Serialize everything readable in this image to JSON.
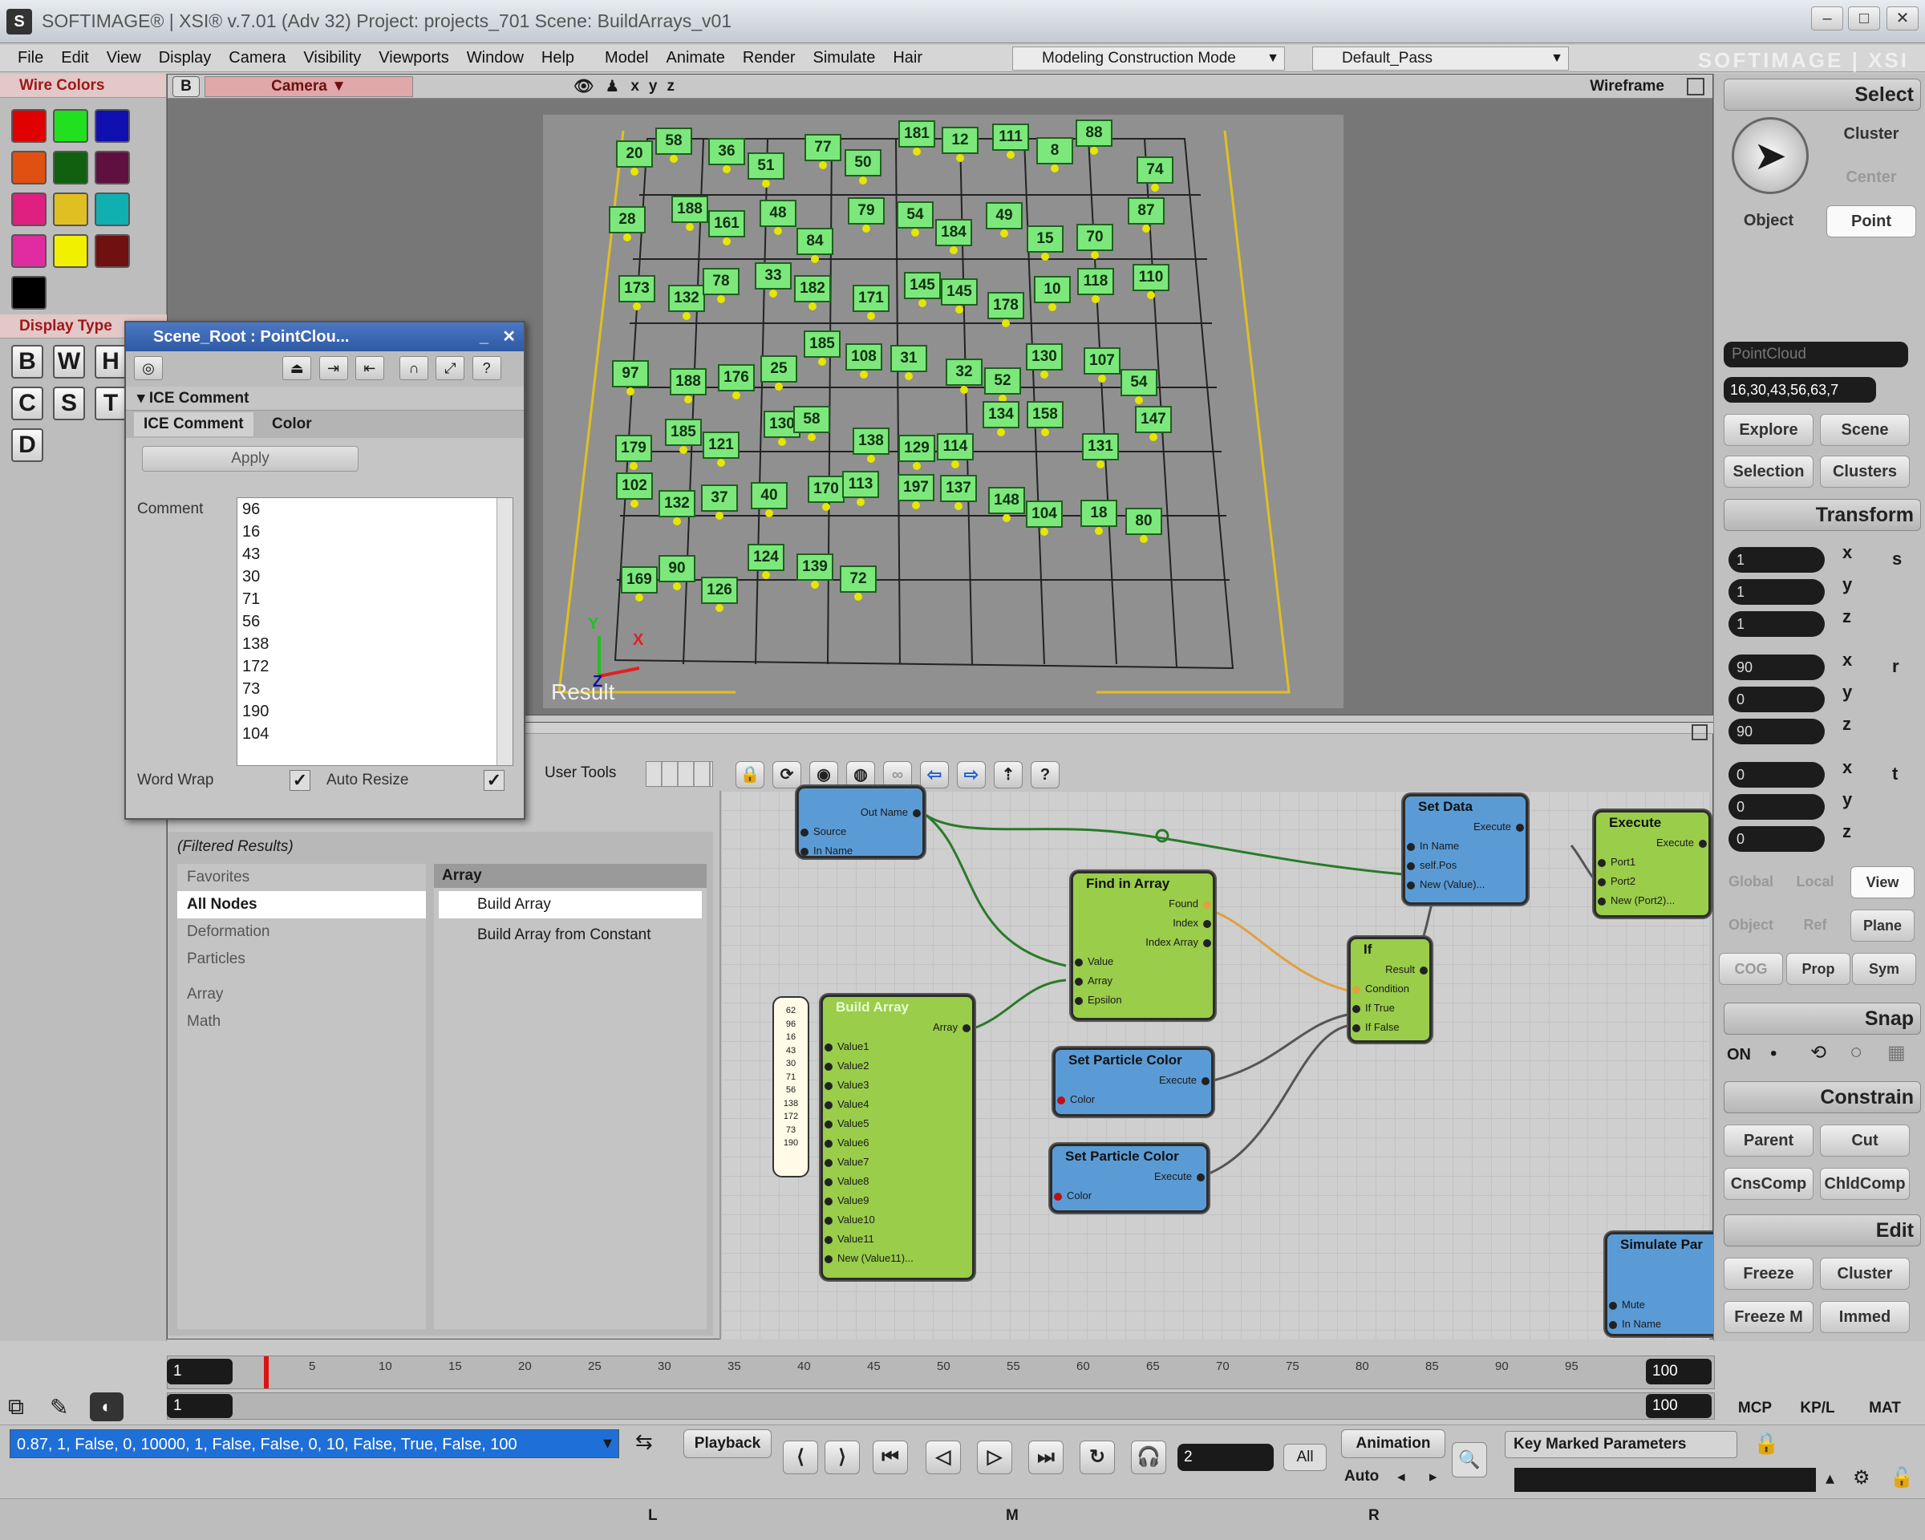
{
  "window": {
    "title": "SOFTIMAGE® | XSI® v.7.01 (Adv 32) Project: projects_701   Scene: BuildArrays_v01",
    "app_icon": "softimage-icon",
    "controls": [
      "–",
      "□",
      "✕"
    ]
  },
  "menubar": {
    "items": [
      "File",
      "Edit",
      "View",
      "Display",
      "Camera",
      "Visibility",
      "Viewports",
      "Window",
      "Help",
      "Model",
      "Animate",
      "Render",
      "Simulate",
      "Hair"
    ],
    "mode": "Modeling Construction Mode",
    "pass": "Default_Pass",
    "brand": "SOFTIMAGE | XSI"
  },
  "left_palette": {
    "wire_colors_title": "Wire Colors",
    "wire_colors": [
      "#e00000",
      "#20e020",
      "#1010b0",
      "#e05010",
      "#106010",
      "#601040",
      "#e02080",
      "#e0c020",
      "#10b0b0",
      "#e02ca0",
      "#f0f000",
      "#701010",
      "#000000"
    ],
    "display_type_title": "Display Type",
    "display_types": [
      "B",
      "W",
      "H",
      "C",
      "S",
      "T",
      "D"
    ]
  },
  "viewport": {
    "label": "B",
    "camera": "Camera",
    "axes": [
      "x",
      "y",
      "z"
    ],
    "mode": "Wireframe",
    "result_label": "Result",
    "axis_x": "X",
    "axis_y": "Y",
    "axis_z": "Z",
    "tags": [
      "20",
      "58",
      "36",
      "51",
      "77",
      "50",
      "181",
      "12",
      "111",
      "8",
      "88",
      "74",
      "28",
      "188",
      "161",
      "48",
      "84",
      "79",
      "54",
      "184",
      "49",
      "15",
      "70",
      "87",
      "173",
      "132",
      "78",
      "33",
      "182",
      "171",
      "145",
      "145",
      "178",
      "10",
      "118",
      "110",
      "97",
      "188",
      "176",
      "25",
      "185",
      "108",
      "31",
      "32",
      "52",
      "130",
      "107",
      "54",
      "179",
      "185",
      "121",
      "130",
      "58",
      "138",
      "129",
      "114",
      "134",
      "158",
      "131",
      "147",
      "102",
      "132",
      "37",
      "40",
      "170",
      "113",
      "197",
      "137",
      "148",
      "104",
      "18",
      "80",
      "169",
      "90",
      "126",
      "124",
      "139",
      "72"
    ]
  },
  "property_editor": {
    "title": "Scene_Root : PointClou...",
    "section": "ICE Comment",
    "tabs": [
      "ICE Comment",
      "Color"
    ],
    "apply_label": "Apply",
    "comment_label": "Comment",
    "comment_lines": [
      "96",
      "16",
      "43",
      "30",
      "71",
      "56",
      "138",
      "172",
      "73",
      "190",
      "104"
    ],
    "word_wrap_label": "Word Wrap",
    "auto_resize_label": "Auto Resize"
  },
  "ice_tree": {
    "user_tools_label": "User Tools",
    "filtered_results": "(Filtered Results)",
    "categories": [
      "Favorites",
      "All Nodes",
      "Deformation",
      "Particles",
      "Array",
      "Math"
    ],
    "selected_category": "All Nodes",
    "group_header": "Array",
    "compounds": [
      "Build Array",
      "Build Array from Constant"
    ],
    "nodes": {
      "get": {
        "title": "",
        "ports_out": [
          "Out Name"
        ],
        "ports_in": [
          "Source",
          "In Name"
        ]
      },
      "set_data": {
        "title": "Set Data",
        "out": "Execute",
        "ports_in": [
          "In Name",
          "self.Pos",
          "New (Value)..."
        ]
      },
      "execute": {
        "title": "Execute",
        "out": "Execute",
        "ports_in": [
          "Port1",
          "Port2",
          "New (Port2)..."
        ]
      },
      "find_in_array": {
        "title": "Find in Array",
        "outs": [
          "Found",
          "Index",
          "Index Array"
        ],
        "ins": [
          "Value",
          "Array",
          "Epsilon"
        ]
      },
      "if": {
        "title": "If",
        "out": "Result",
        "ins": [
          "Condition",
          "If True",
          "If False"
        ]
      },
      "build_array": {
        "title": "Build Array",
        "out": "Array",
        "ins": [
          "Value1",
          "Value2",
          "Value3",
          "Value4",
          "Value5",
          "Value6",
          "Value7",
          "Value8",
          "Value9",
          "Value10",
          "Value11",
          "New (Value11)..."
        ]
      },
      "set_color_1": {
        "title": "Set Particle Color",
        "out": "Execute",
        "in": "Color"
      },
      "set_color_2": {
        "title": "Set Particle Color",
        "out": "Execute",
        "in": "Color"
      },
      "simulate": {
        "title": "Simulate Par",
        "ins": [
          "Mute",
          "In Name"
        ]
      }
    },
    "comment_node_values": [
      "62",
      "96",
      "16",
      "43",
      "30",
      "71",
      "56",
      "138",
      "172",
      "73",
      "190"
    ]
  },
  "right_panel": {
    "select_title": "Select",
    "cluster": "Cluster",
    "center": "Center",
    "object": "Object",
    "point": "Point",
    "pointcloud_field": "PointCloud",
    "selection_field": "16,30,43,56,63,7",
    "explore": "Explore",
    "scene": "Scene",
    "selection": "Selection",
    "clusters": "Clusters",
    "transform_title": "Transform",
    "scale": [
      "1",
      "1",
      "1"
    ],
    "rotate": [
      "90",
      "0",
      "90"
    ],
    "translate": [
      "0",
      "0",
      "0"
    ],
    "axes": [
      "x",
      "y",
      "z"
    ],
    "srt": [
      "s",
      "r",
      "t"
    ],
    "ref_row1": [
      "Global",
      "Local",
      "View"
    ],
    "ref_row2": [
      "Object",
      "Ref",
      "Plane"
    ],
    "ref_row3": [
      "COG",
      "Prop",
      "Sym"
    ],
    "snap_title": "Snap",
    "snap_on": "ON",
    "constrain_title": "Constrain",
    "constrain_buttons": [
      "Parent",
      "Cut",
      "CnsComp",
      "ChldComp"
    ],
    "edit_title": "Edit",
    "edit_buttons": [
      "Freeze",
      "Cluster",
      "Freeze M",
      "Immed"
    ],
    "bottom_tabs": [
      "MCP",
      "KP/L",
      "MAT"
    ]
  },
  "timeline": {
    "start": "1",
    "end": "100",
    "range_start": "1",
    "range_end": "100",
    "ticks": [
      "5",
      "10",
      "15",
      "20",
      "25",
      "30",
      "35",
      "40",
      "45",
      "50",
      "55",
      "60",
      "65",
      "70",
      "75",
      "80",
      "85",
      "90",
      "95"
    ]
  },
  "bottom": {
    "command": "0.87, 1, False, 0, 10000, 1, False, False, 0, 10, False, True, False, 100",
    "playback": "Playback",
    "frame": "2",
    "all": "All",
    "animation": "Animation",
    "auto": "Auto",
    "key_marked": "Key Marked Parameters",
    "mouse_l": "L",
    "mouse_m": "M",
    "mouse_r": "R"
  }
}
